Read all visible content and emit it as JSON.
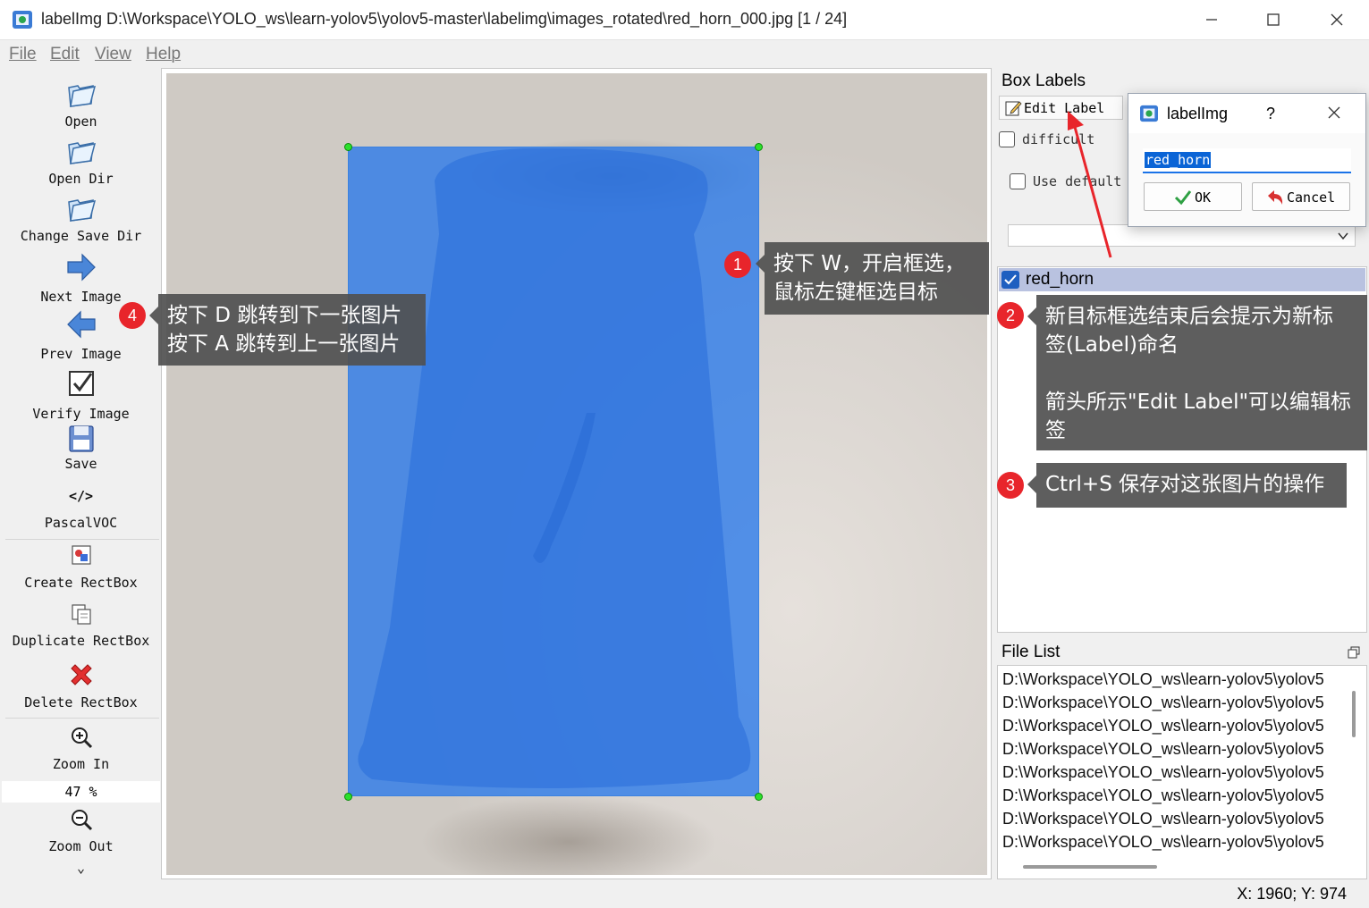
{
  "window": {
    "title": "labelImg D:\\Workspace\\YOLO_ws\\learn-yolov5\\yolov5-master\\labelimg\\images_rotated\\red_horn_000.jpg [1 / 24]"
  },
  "menu": [
    "File",
    "Edit",
    "View",
    "Help"
  ],
  "toolbar": {
    "open": "Open",
    "open_dir": "Open Dir",
    "change_save_dir": "Change Save Dir",
    "next_image": "Next Image",
    "prev_image": "Prev Image",
    "verify_image": "Verify Image",
    "save": "Save",
    "format_symbol": "</>",
    "format": "PascalVOC",
    "create_rectbox": "Create RectBox",
    "duplicate_rectbox": "Duplicate RectBox",
    "delete_rectbox": "Delete RectBox",
    "zoom_in": "Zoom In",
    "zoom_value": "47 %",
    "zoom_out": "Zoom Out",
    "more": "⌄"
  },
  "box_labels": {
    "title": "Box Labels",
    "edit_label_button": "Edit Label",
    "difficult": "difficult",
    "use_default": "Use default",
    "items": [
      {
        "label": "red_horn",
        "checked": true
      }
    ]
  },
  "file_list": {
    "title": "File List",
    "items": [
      "D:\\Workspace\\YOLO_ws\\learn-yolov5\\yolov5",
      "D:\\Workspace\\YOLO_ws\\learn-yolov5\\yolov5",
      "D:\\Workspace\\YOLO_ws\\learn-yolov5\\yolov5",
      "D:\\Workspace\\YOLO_ws\\learn-yolov5\\yolov5",
      "D:\\Workspace\\YOLO_ws\\learn-yolov5\\yolov5",
      "D:\\Workspace\\YOLO_ws\\learn-yolov5\\yolov5",
      "D:\\Workspace\\YOLO_ws\\learn-yolov5\\yolov5",
      "D:\\Workspace\\YOLO_ws\\learn-yolov5\\yolov5"
    ]
  },
  "status": {
    "coords": "X: 1960; Y: 974"
  },
  "dialog": {
    "title": "labelImg",
    "help": "?",
    "input_value": "red_horn",
    "ok": "OK",
    "cancel": "Cancel"
  },
  "annotations": {
    "a1": {
      "num": "1",
      "text": "按下 W，开启框选，\n鼠标左键框选目标"
    },
    "a2": {
      "num": "2",
      "text": "新目标框选结束后会提示为新标\n签(Label)命名\n\n箭头所示\"Edit Label\"可以编辑标\n签"
    },
    "a3": {
      "num": "3",
      "text": "Ctrl+S 保存对这张图片的操作"
    },
    "a4": {
      "num": "4",
      "text": "按下 D 跳转到下一张图片\n按下 A 跳转到上一张图片"
    }
  },
  "colors": {
    "bbox_fill": "#2878eb",
    "handle": "#2ce02c",
    "badge": "#e8252b",
    "callout_bg": "#505050",
    "selected_row": "#b9c2e0",
    "arrow": "#e8252b"
  }
}
